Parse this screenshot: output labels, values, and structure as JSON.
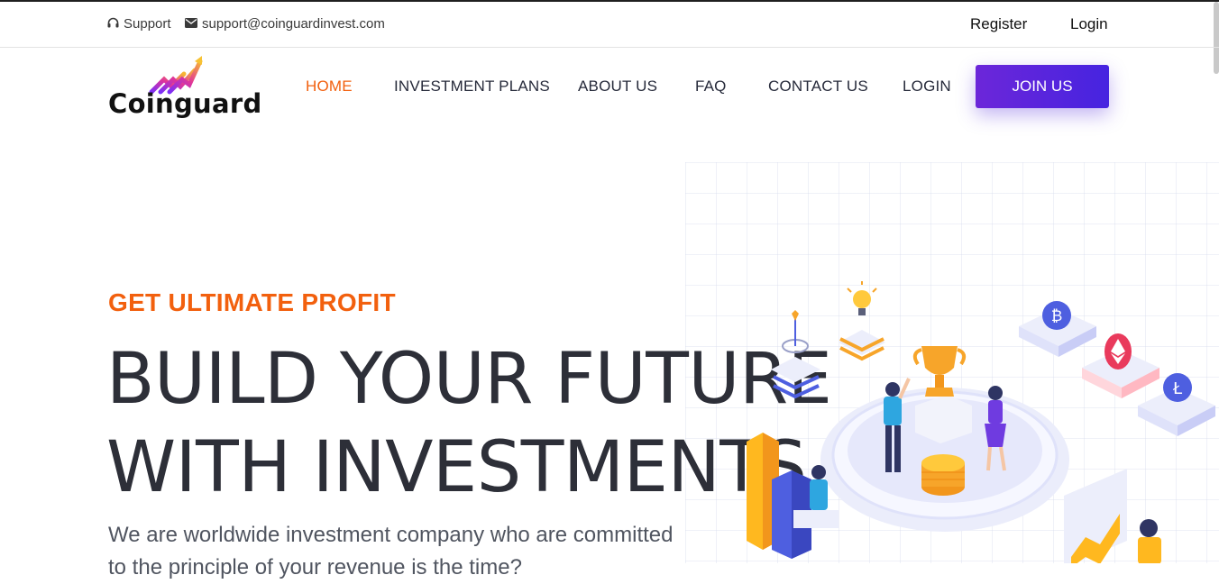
{
  "topbar": {
    "support_label": "Support",
    "email": "support@coinguardinvest.com",
    "register_label": "Register",
    "login_label": "Login"
  },
  "brand": {
    "name": "Coinguard"
  },
  "nav": {
    "items": [
      {
        "label": "HOME",
        "active": true
      },
      {
        "label": "INVESTMENT PLANS"
      },
      {
        "label": "ABOUT US"
      },
      {
        "label": "FAQ"
      },
      {
        "label": "CONTACT US"
      },
      {
        "label": "LOGIN"
      }
    ],
    "cta_label": "JOIN US"
  },
  "hero": {
    "eyebrow": "GET ULTIMATE PROFIT",
    "title_line1": "BUILD YOUR FUTURE",
    "title_line2": "WITH INVESTMENTS",
    "description": "We are worldwide investment company who are committed to the principle of your revenue is the time?"
  },
  "colors": {
    "accent": "#f2600e",
    "cta_start": "#6c26d9",
    "cta_end": "#4624e0"
  },
  "icons": [
    "headphones-icon",
    "envelope-icon",
    "logo-mark-icon",
    "bitcoin-icon",
    "ethereum-icon",
    "litecoin-icon",
    "trophy-icon",
    "lightbulb-icon",
    "target-icon"
  ]
}
